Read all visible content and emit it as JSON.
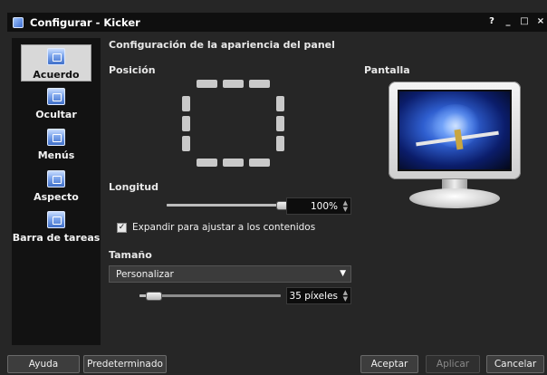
{
  "window": {
    "title": "Configurar - Kicker",
    "controls": [
      "?",
      "_",
      "□",
      "×"
    ]
  },
  "sidebar": {
    "items": [
      {
        "label": "Acuerdo",
        "icon": "panel-icon",
        "active": true
      },
      {
        "label": "Ocultar",
        "icon": "panel-icon",
        "active": false
      },
      {
        "label": "Menús",
        "icon": "panel-icon",
        "active": false
      },
      {
        "label": "Aspecto",
        "icon": "panel-icon",
        "active": false
      },
      {
        "label": "Barra de tareas",
        "icon": "taskbar-icon",
        "active": false
      }
    ]
  },
  "main": {
    "heading": "Configuración de la apariencia del panel",
    "position_label": "Posición",
    "screen_label": "Pantalla",
    "length_label": "Longitud",
    "length_value": "100%",
    "length_fraction": 1.0,
    "expand_checkbox_label": "Expandir para ajustar a los contenidos",
    "expand_checked": true,
    "size_label": "Tamaño",
    "size_select_value": "Personalizar",
    "size_value": "35 píxeles",
    "size_fraction": 0.1
  },
  "footer": {
    "help": "Ayuda",
    "defaults": "Predeterminado",
    "accept": "Aceptar",
    "apply": "Aplicar",
    "cancel": "Cancelar"
  },
  "colors": {
    "background": "#262626",
    "titlebar": "#0f0f0f",
    "sidebar": "#121212",
    "active_item": "#d8d8d8"
  }
}
